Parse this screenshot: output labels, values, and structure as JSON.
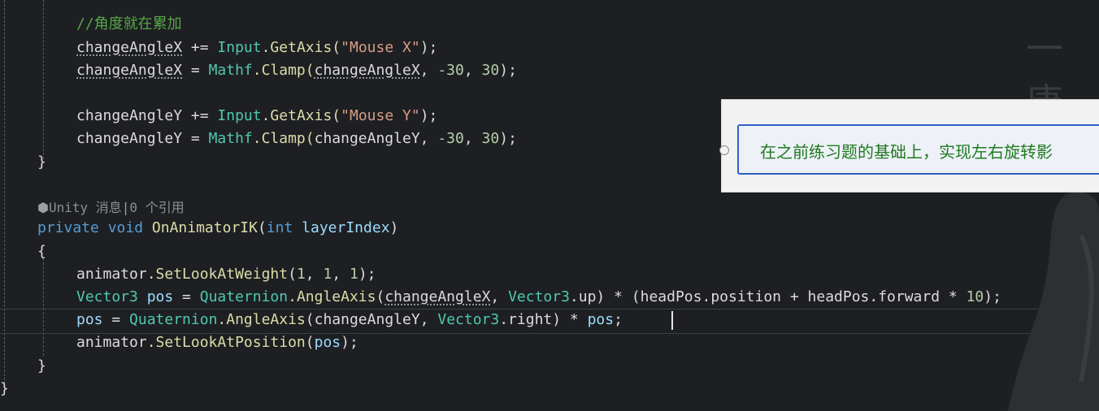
{
  "editor": {
    "lines": {
      "comment": "//角度就在累加",
      "l1": {
        "var": "changeAngleX",
        "op": " += ",
        "type": "Input",
        "method": ".GetAxis(",
        "str": "\"Mouse X\"",
        "end": ");"
      },
      "l2": {
        "var": "changeAngleX",
        "op": " = ",
        "type": "Mathf",
        "method": ".Clamp(",
        "arg": "changeAngleX",
        "sep1": ", ",
        "n1": "-30",
        "sep2": ", ",
        "n2": "30",
        "end": ");"
      },
      "l3": {
        "var": "changeAngleY",
        "op": " += ",
        "type": "Input",
        "method": ".GetAxis(",
        "str": "\"Mouse Y\"",
        "end": ");"
      },
      "l4": {
        "var": "changeAngleY",
        "op": " = ",
        "type": "Mathf",
        "method": ".Clamp(",
        "arg": "changeAngleY",
        "sep1": ", ",
        "n1": "-30",
        "sep2": ", ",
        "n2": "30",
        "end": ");"
      },
      "close1": "}",
      "codelens": {
        "icon": "⬢",
        "unity": "Unity 消息",
        "sep": "|",
        "refs": "0 个引用"
      },
      "sig": {
        "kw1": "private",
        "kw2": "void",
        "method": "OnAnimatorIK",
        "open": "(",
        "ptype": "int",
        "pname": "layerIndex",
        "close": ")"
      },
      "open2": "{",
      "l5": {
        "obj": "animator",
        "method": ".SetLookAtWeight",
        "open": "(",
        "n1": "1",
        "sep1": ", ",
        "n2": "1",
        "sep2": ", ",
        "n3": "1",
        "end": ");"
      },
      "l6": {
        "type": "Vector3",
        "var": "pos",
        "op": " = ",
        "type2": "Quaternion",
        "method": ".AngleAxis",
        "open": "(",
        "arg": "changeAngleX",
        "sep": ", ",
        "type3": "Vector3",
        "rest": ".up) * (headPos.position + headPos.forward * ",
        "num": "10",
        "end": ");"
      },
      "l7": {
        "var": "pos",
        "op": " = ",
        "type": "Quaternion",
        "method": ".AngleAxis",
        "open": "(",
        "arg": "changeAngleY",
        "sep": ", ",
        "type2": "Vector3",
        "rest": ".right) * ",
        "var2": "pos",
        "end": ";"
      },
      "l8": {
        "obj": "animator",
        "method": ".SetLookAtPosition",
        "open": "(",
        "var": "pos",
        "end": ");"
      },
      "close2": "}",
      "close3": "}"
    }
  },
  "overlay": {
    "watermark": "一唐",
    "popup_text": "在之前练习题的基础上，实现左右旋转影"
  },
  "colors": {
    "background": "#1e1f22",
    "keyword": "#569cd6",
    "type": "#4ec9b0",
    "method": "#dcdcaa",
    "string": "#d69d85",
    "number": "#b5cea8",
    "comment": "#57a64a",
    "parameter": "#9cdcfe",
    "popup_text": "#1f7a1f",
    "popup_border": "#2f60c9"
  }
}
